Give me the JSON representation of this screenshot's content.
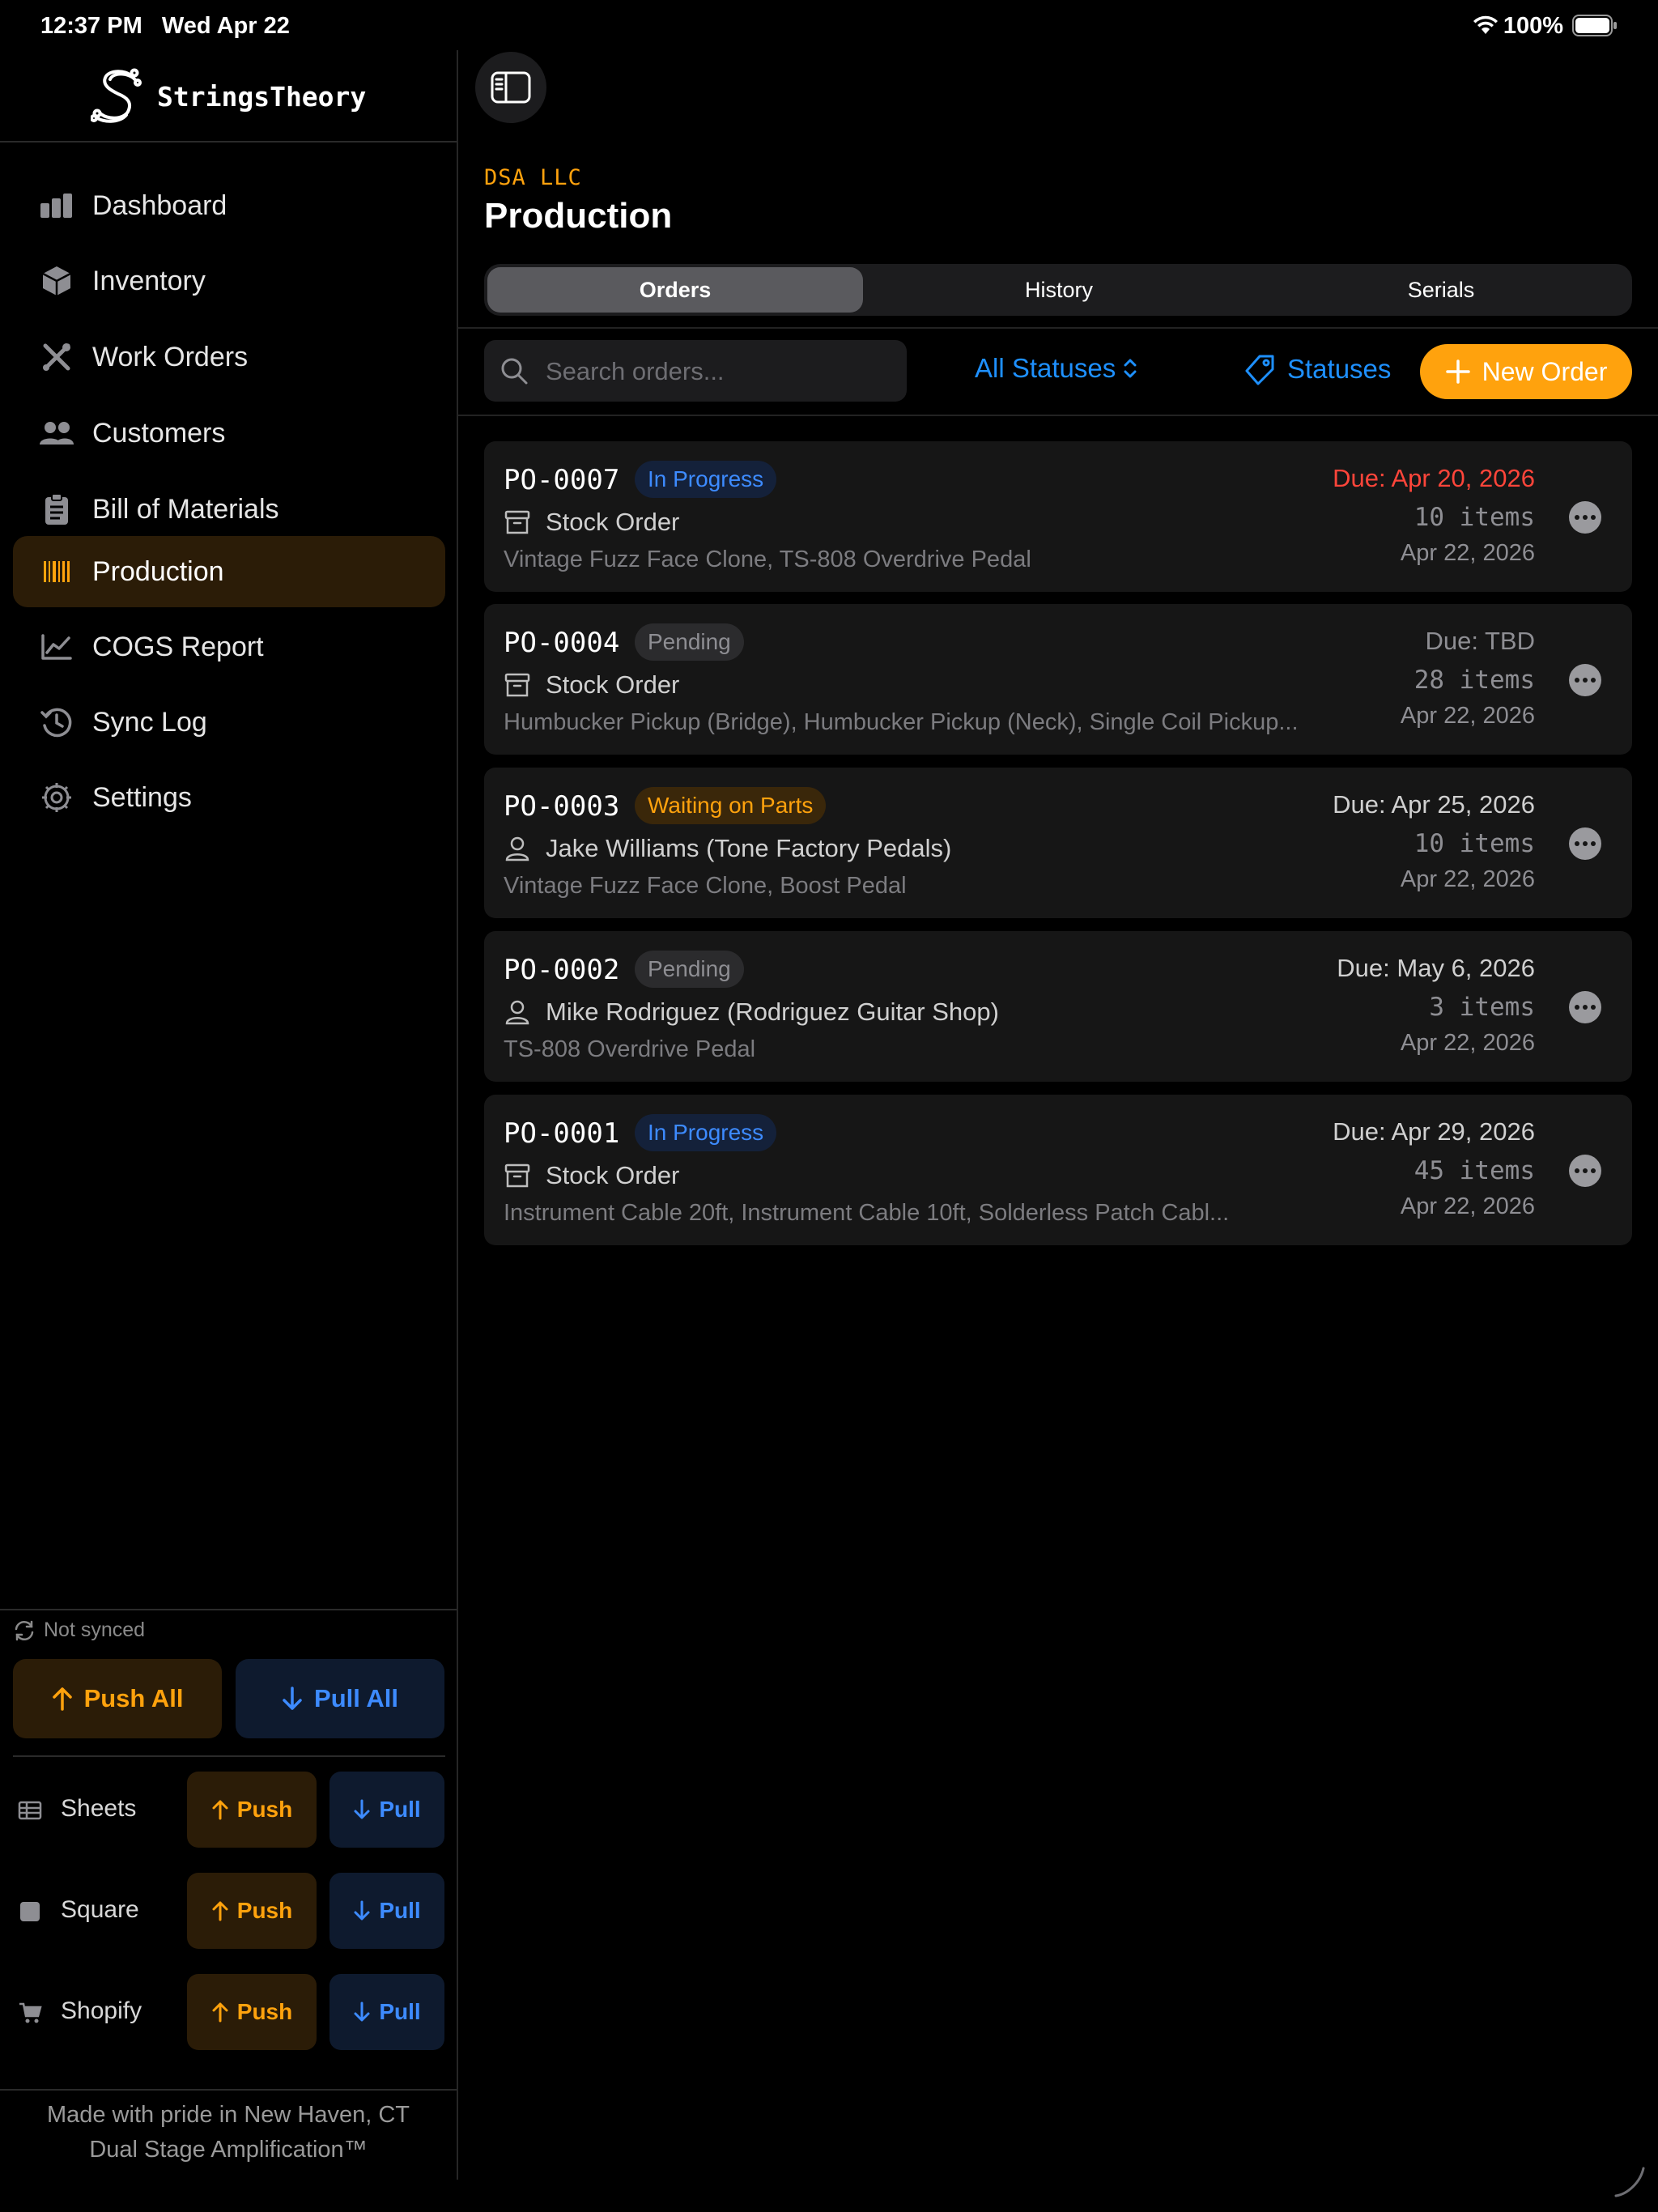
{
  "status_bar": {
    "time": "12:37 PM",
    "date": "Wed Apr 22",
    "battery": "100%"
  },
  "brand": {
    "name": "StringsTheory"
  },
  "sidebar": {
    "items": [
      {
        "label": "Dashboard",
        "icon": "chart-bar-icon"
      },
      {
        "label": "Inventory",
        "icon": "cube-box-icon"
      },
      {
        "label": "Work Orders",
        "icon": "wrench-screwdriver-icon"
      },
      {
        "label": "Customers",
        "icon": "people-icon"
      },
      {
        "label": "Bill of Materials",
        "icon": "clipboard-icon"
      },
      {
        "label": "Production",
        "icon": "barcode-icon",
        "active": true
      },
      {
        "label": "COGS Report",
        "icon": "line-chart-icon"
      },
      {
        "label": "Sync Log",
        "icon": "clock-history-icon"
      },
      {
        "label": "Settings",
        "icon": "gear-icon"
      }
    ],
    "sync": {
      "status": "Not synced",
      "push_all": "Push All",
      "pull_all": "Pull All",
      "services": [
        {
          "name": "Sheets",
          "push": "Push",
          "pull": "Pull"
        },
        {
          "name": "Square",
          "push": "Push",
          "pull": "Pull"
        },
        {
          "name": "Shopify",
          "push": "Push",
          "pull": "Pull"
        }
      ]
    },
    "footer": {
      "line1": "Made with pride in New Haven, CT",
      "line2": "Dual Stage Amplification™"
    }
  },
  "main": {
    "company": "DSA LLC",
    "title": "Production",
    "tabs": [
      {
        "label": "Orders",
        "active": true
      },
      {
        "label": "History"
      },
      {
        "label": "Serials"
      }
    ],
    "search": {
      "placeholder": "Search orders...",
      "value": ""
    },
    "status_filter": "All Statuses",
    "statuses_button": "Statuses",
    "new_order_button": "New Order",
    "orders": [
      {
        "id": "PO-0007",
        "status": "In Progress",
        "customer": "Stock Order",
        "customer_type": "stock",
        "items": "Vintage Fuzz Face Clone, TS-808 Overdrive Pedal",
        "due": "Due: Apr 20, 2026",
        "overdue": true,
        "count": "10 items",
        "date": "Apr 22, 2026"
      },
      {
        "id": "PO-0004",
        "status": "Pending",
        "customer": "Stock Order",
        "customer_type": "stock",
        "items": "Humbucker Pickup (Bridge), Humbucker Pickup (Neck), Single Coil Pickup...",
        "due": "Due: TBD",
        "overdue": false,
        "count": "28 items",
        "date": "Apr 22, 2026"
      },
      {
        "id": "PO-0003",
        "status": "Waiting on Parts",
        "customer": "Jake Williams (Tone Factory Pedals)",
        "customer_type": "person",
        "items": "Vintage Fuzz Face Clone, Boost Pedal",
        "due": "Due: Apr 25, 2026",
        "overdue": false,
        "count": "10 items",
        "date": "Apr 22, 2026"
      },
      {
        "id": "PO-0002",
        "status": "Pending",
        "customer": "Mike Rodriguez (Rodriguez Guitar Shop)",
        "customer_type": "person",
        "items": "TS-808 Overdrive Pedal",
        "due": "Due: May 6, 2026",
        "overdue": false,
        "count": "3 items",
        "date": "Apr 22, 2026"
      },
      {
        "id": "PO-0001",
        "status": "In Progress",
        "customer": "Stock Order",
        "customer_type": "stock",
        "items": "Instrument Cable 20ft, Instrument Cable 10ft, Solderless Patch Cabl...",
        "due": "Due: Apr 29, 2026",
        "overdue": false,
        "count": "45 items",
        "date": "Apr 22, 2026"
      }
    ]
  },
  "colors": {
    "accent": "#ffa20d",
    "link": "#1e90ff",
    "pull": "#3d8bff",
    "overdue": "#ff453a"
  }
}
